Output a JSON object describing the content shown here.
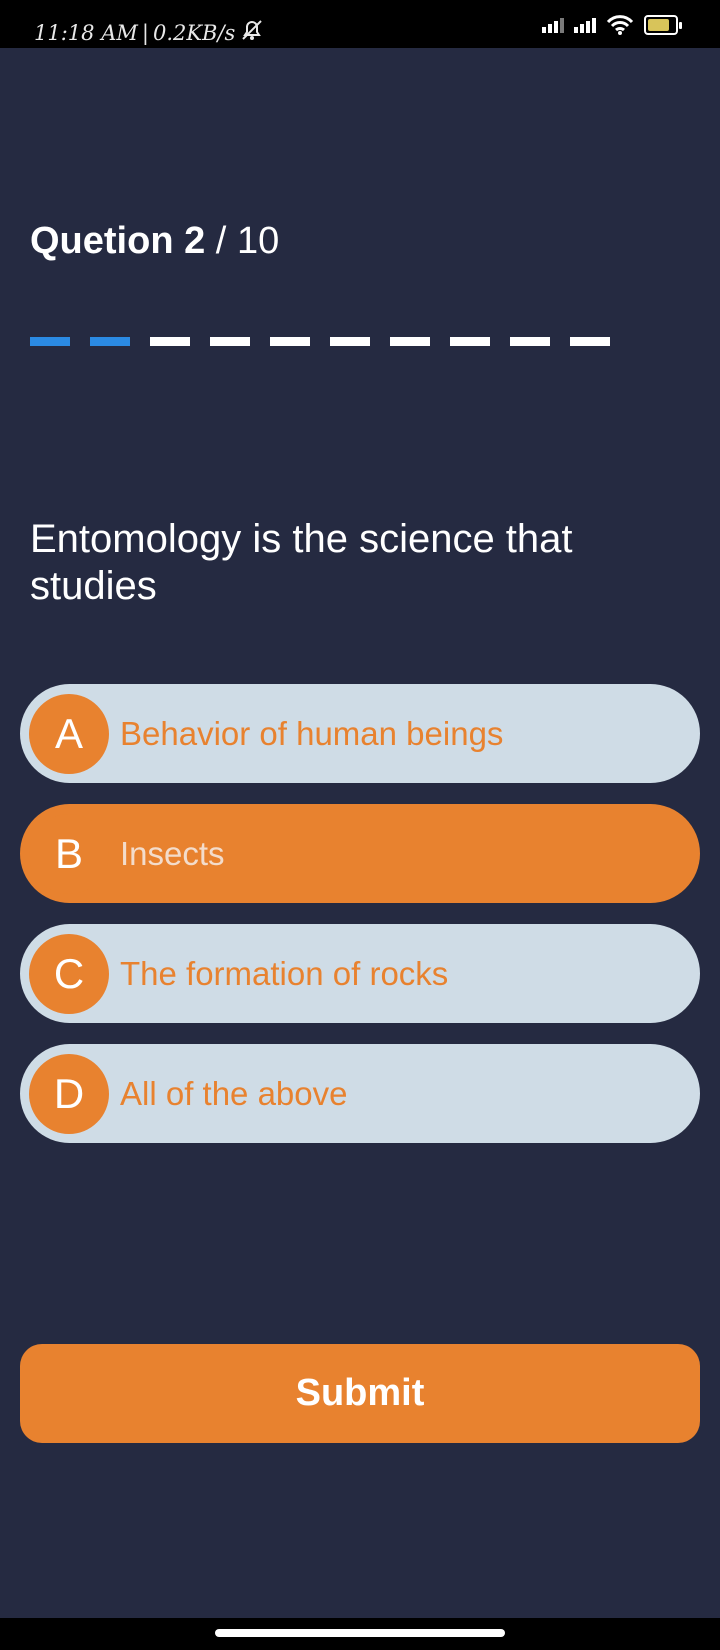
{
  "status_bar": {
    "time": "11:18 AM",
    "separator": "|",
    "speed": "0.2KB/s",
    "icons": [
      "alarm-off-icon",
      "signal-icon",
      "signal-icon",
      "wifi-icon",
      "battery-charging-icon"
    ],
    "battery_level": 0.8
  },
  "header": {
    "label": "Quetion",
    "current": "2",
    "separator": " / ",
    "total": "10"
  },
  "progress": {
    "completed": 2,
    "total": 10,
    "done_color": "#2b8ae3",
    "pending_color": "#ffffff"
  },
  "question": {
    "text": "Entomology is the science that studies"
  },
  "options": [
    {
      "letter": "A",
      "text": "Behavior of human beings",
      "selected": false
    },
    {
      "letter": "B",
      "text": "Insects",
      "selected": true
    },
    {
      "letter": "C",
      "text": "The formation of rocks",
      "selected": false
    },
    {
      "letter": "D",
      "text": "All of the above",
      "selected": false
    }
  ],
  "submit": {
    "label": "Submit"
  },
  "colors": {
    "background": "#252a41",
    "accent": "#e8822f",
    "option_bg": "#cfdce6"
  }
}
